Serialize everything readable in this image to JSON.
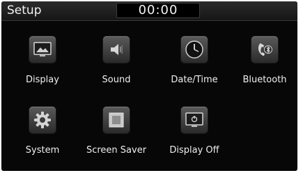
{
  "header": {
    "title": "Setup",
    "clock": "00:00"
  },
  "items": [
    {
      "label": "Display",
      "icon": "display-icon"
    },
    {
      "label": "Sound",
      "icon": "speaker-icon"
    },
    {
      "label": "Date/Time",
      "icon": "clock-icon"
    },
    {
      "label": "Bluetooth",
      "icon": "bluetooth-phone-icon"
    },
    {
      "label": "System",
      "icon": "gear-icon"
    },
    {
      "label": "Screen Saver",
      "icon": "screen-saver-icon"
    },
    {
      "label": "Display Off",
      "icon": "display-off-icon"
    }
  ]
}
